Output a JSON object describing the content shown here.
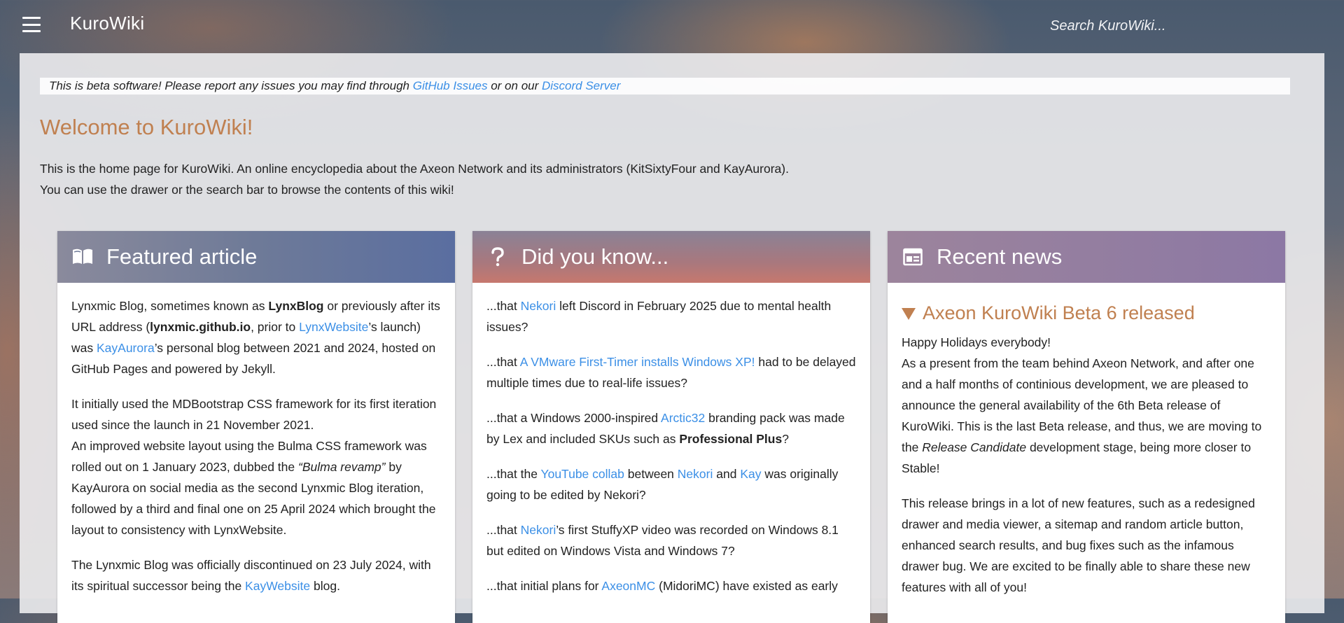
{
  "header": {
    "brand": "KuroWiki",
    "search_placeholder": "Search KuroWiki...",
    "menu_icon": "hamburger-menu-icon"
  },
  "beta_notice": {
    "text": "This is beta software! Please report any issues you may find through",
    "link1": "GitHub Issues",
    "middle": "or on our",
    "link2": "Discord Server"
  },
  "welcome": {
    "title": "Welcome to KuroWiki!",
    "line1": "This is the home page for KuroWiki. An online encyclopedia about the Axeon Network and its administrators (KitSixtyFour and KayAurora).",
    "line2": "You can use the drawer or the search bar to browse the contents of this wiki!"
  },
  "colors": {
    "accent": "#c08050",
    "link": "#3b8fe6"
  },
  "featured": {
    "icon": "open-book-icon",
    "title": "Featured article",
    "p1": {
      "a": "Lynxmic Blog, sometimes known as",
      "b1": "LynxBlog",
      "c": "or previously after its URL address (",
      "b2": "lynxmic.github.io",
      "d": ", prior to",
      "link1": "LynxWebsite",
      "e": "’s launch) was",
      "link2": "KayAurora",
      "f": "’s personal blog between 2021 and 2024, hosted on GitHub Pages and powered by Jekyll."
    },
    "p2": {
      "a": "It initially used the MDBootstrap CSS framework for its first iteration used since the launch in 21 November 2021.",
      "b": "An improved website layout using the Bulma CSS framework was rolled out on 1 January 2023, dubbed the",
      "em": "“Bulma revamp”",
      "c": "by KayAurora on social media as the second Lynxmic Blog iteration, followed by a third and final one on 25 April 2024 which brought the layout to consistency with LynxWebsite."
    },
    "p3": {
      "a": "The Lynxmic Blog was officially discontinued on 23 July 2024, with its spiritual successor being the",
      "link": "KayWebsite",
      "b": "blog."
    }
  },
  "dyk": {
    "icon": "question-mark-icon",
    "title": "Did you know...",
    "items": [
      {
        "a": "...that",
        "l1": "Nekori",
        "b": "left Discord in February 2025 due to mental health issues?"
      },
      {
        "a": "...that",
        "l1": "A VMware First-Timer installs Windows XP!",
        "b": "had to be delayed multiple times due to real-life issues?"
      },
      {
        "a": "...that a Windows 2000-inspired",
        "l1": "Arctic32",
        "b": "branding pack was made by Lex and included SKUs such as",
        "bold": "Professional Plus",
        "c": "?"
      },
      {
        "a": "...that the",
        "l1": "YouTube collab",
        "b": "between",
        "l2": "Nekori",
        "c": "and",
        "l3": "Kay",
        "d": "was originally going to be edited by Nekori?"
      },
      {
        "a": "...that",
        "l1": "Nekori",
        "b": "’s first StuffyXP video was recorded on Windows 8.1 but edited on Windows Vista and Windows 7?"
      },
      {
        "a": "...that initial plans for",
        "l1": "AxeonMC",
        "b": "(MidoriMC) have existed as early"
      }
    ]
  },
  "news": {
    "icon": "newspaper-icon",
    "title": "Recent news",
    "item_title": "Axeon KuroWiki Beta 6 released",
    "p1": {
      "a": "Happy Holidays everybody!",
      "b": "As a present from the team behind Axeon Network, and after one and a half months of continious development, we are pleased to announce the general availability of the 6th Beta release of KuroWiki. This is the last Beta release, and thus, we are moving to the",
      "em": "Release Candidate",
      "c": "development stage, being more closer to Stable!"
    },
    "p2": "This release brings in a lot of new features, such as a redesigned drawer and media viewer, a sitemap and random article button, enhanced search results, and bug fixes such as the infamous drawer bug. We are excited to be finally able to share these new features with all of you!"
  }
}
